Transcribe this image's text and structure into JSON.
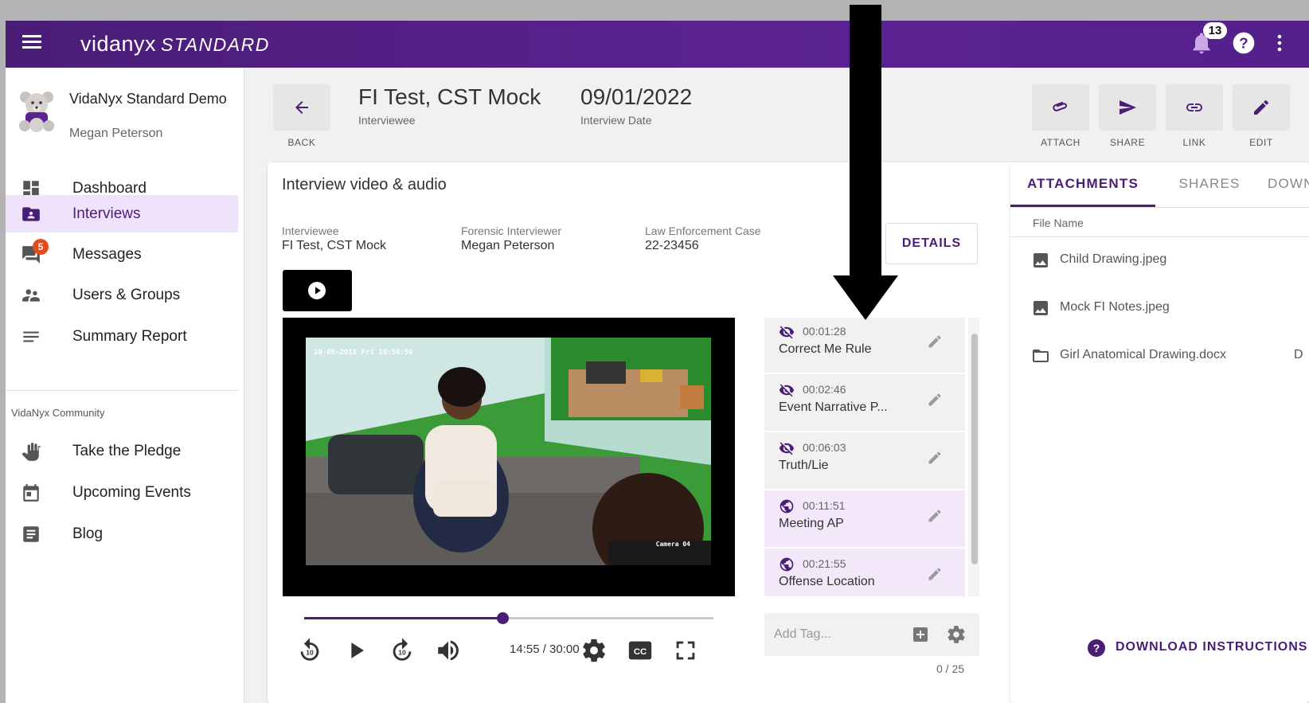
{
  "topbar": {
    "logo_brand": "vidanyx",
    "logo_edition": "STANDARD",
    "notification_count": "13"
  },
  "sidebar": {
    "org_name": "VidaNyx Standard Demo",
    "user_name": "Megan Peterson",
    "items": [
      {
        "label": "Dashboard",
        "icon": "dashboard-icon"
      },
      {
        "label": "Interviews",
        "icon": "interview-folder-icon"
      },
      {
        "label": "Messages",
        "icon": "messages-icon",
        "badge": "5"
      },
      {
        "label": "Users & Groups",
        "icon": "users-icon"
      },
      {
        "label": "Summary Report",
        "icon": "summary-lines-icon"
      }
    ],
    "community_label": "VidaNyx Community",
    "community_items": [
      {
        "label": "Take the Pledge",
        "icon": "hand-icon"
      },
      {
        "label": "Upcoming Events",
        "icon": "calendar-icon"
      },
      {
        "label": "Blog",
        "icon": "blog-icon"
      }
    ]
  },
  "header": {
    "back_label": "BACK",
    "interviewee_name": "FI Test, CST Mock",
    "interviewee_caption": "Interviewee",
    "interview_date": "09/01/2022",
    "interview_date_caption": "Interview Date",
    "actions": [
      "ATTACH",
      "SHARE",
      "LINK",
      "EDIT"
    ]
  },
  "video_card": {
    "title": "Interview video & audio",
    "meta": [
      {
        "label": "Interviewee",
        "value": "FI Test, CST Mock"
      },
      {
        "label": "Forensic Interviewer",
        "value": "Megan Peterson"
      },
      {
        "label": "Law Enforcement Case",
        "value": "22-23456"
      }
    ],
    "details_label": "DETAILS",
    "video_timestamp": "10-05-2018 Fri 10:50:56",
    "camera_label": "Camera 04",
    "progress_fraction": 0.485,
    "timecode": "14:55 / 30:00",
    "tags": [
      {
        "time": "00:01:28",
        "name": "Correct Me Rule",
        "visibility": "hidden"
      },
      {
        "time": "00:02:46",
        "name": "Event Narrative P...",
        "visibility": "hidden"
      },
      {
        "time": "00:06:03",
        "name": "Truth/Lie",
        "visibility": "hidden"
      },
      {
        "time": "00:11:51",
        "name": "Meeting AP",
        "visibility": "public"
      },
      {
        "time": "00:21:55",
        "name": "Offense Location",
        "visibility": "public"
      }
    ],
    "add_tag_placeholder": "Add Tag...",
    "tag_counter": "0 / 25"
  },
  "attachments_panel": {
    "tabs": [
      "ATTACHMENTS",
      "SHARES",
      "DOWN"
    ],
    "column_header": "File Name",
    "files": [
      {
        "name": "Child Drawing.jpeg",
        "icon": "image-icon",
        "extra": ""
      },
      {
        "name": "Mock FI Notes.jpeg",
        "icon": "image-icon",
        "extra": ""
      },
      {
        "name": "Girl Anatomical Drawing.docx",
        "icon": "folder-icon",
        "extra": "D"
      }
    ],
    "download_label": "DOWNLOAD INSTRUCTIONS"
  },
  "colors": {
    "brand": "#4a1d77",
    "active_nav": "#efe3fb",
    "badge": "#e64a19"
  }
}
